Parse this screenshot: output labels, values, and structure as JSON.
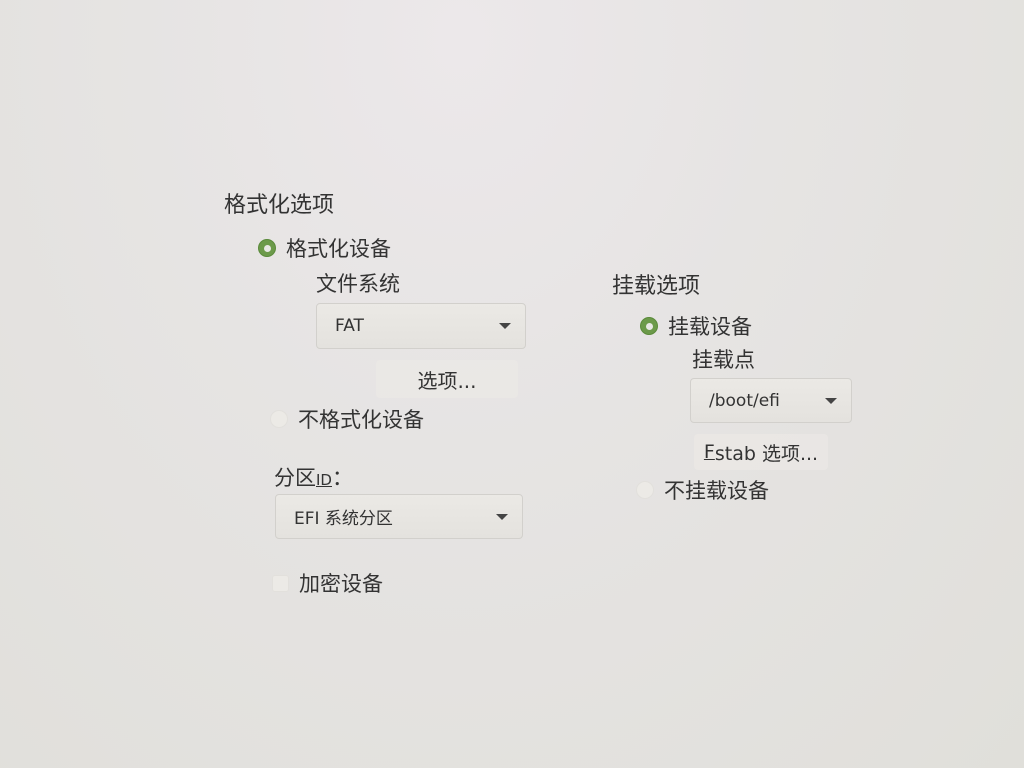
{
  "format": {
    "heading": "格式化选项",
    "format_device": "格式化设备",
    "filesystem_label": "文件系统",
    "filesystem_value": "FAT",
    "options_button": "选项...",
    "no_format": "不格式化设备",
    "partition_id_prefix": "分区",
    "partition_id_mnemonic": "ID",
    "partition_id_suffix": "：",
    "partition_id_value": "EFI 系统分区",
    "encrypt": "加密设备"
  },
  "mount": {
    "heading": "挂载选项",
    "mount_device": "挂载设备",
    "mount_point_label": "挂载点",
    "mount_point_value": "/boot/efi",
    "fstab_mnemonic": "F",
    "fstab_rest": "stab 选项...",
    "no_mount": "不挂载设备"
  },
  "colors": {
    "radio_selected": "#6c9a4a",
    "background": "#e6e4e3"
  }
}
